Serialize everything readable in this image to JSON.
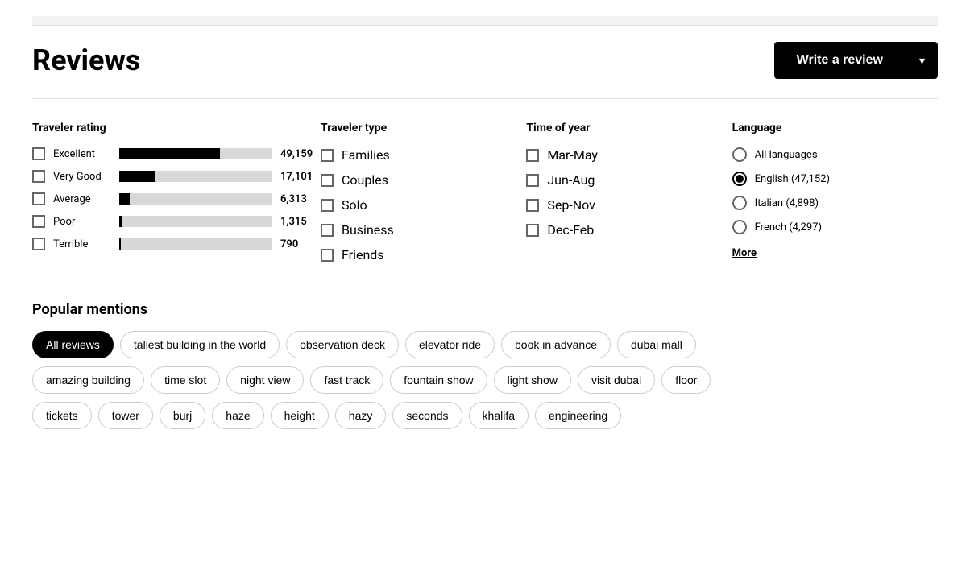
{
  "header": {
    "title": "Reviews",
    "write_review_label": "Write a review",
    "dropdown_icon": "▾"
  },
  "traveler_rating": {
    "title": "Traveler rating",
    "items": [
      {
        "label": "Excellent",
        "count": "49,159",
        "bar_pct": 66
      },
      {
        "label": "Very Good",
        "count": "17,101",
        "bar_pct": 23
      },
      {
        "label": "Average",
        "count": "6,313",
        "bar_pct": 7
      },
      {
        "label": "Poor",
        "count": "1,315",
        "bar_pct": 2
      },
      {
        "label": "Terrible",
        "count": "790",
        "bar_pct": 1
      }
    ]
  },
  "traveler_type": {
    "title": "Traveler type",
    "items": [
      "Families",
      "Couples",
      "Solo",
      "Business",
      "Friends"
    ]
  },
  "time_of_year": {
    "title": "Time of year",
    "items": [
      "Mar-May",
      "Jun-Aug",
      "Sep-Nov",
      "Dec-Feb"
    ]
  },
  "language": {
    "title": "Language",
    "items": [
      {
        "label": "All languages",
        "selected": false
      },
      {
        "label": "English (47,152)",
        "selected": true
      },
      {
        "label": "Italian (4,898)",
        "selected": false
      },
      {
        "label": "French (4,297)",
        "selected": false
      }
    ],
    "more_label": "More"
  },
  "popular_mentions": {
    "title": "Popular mentions",
    "rows": [
      [
        "All reviews",
        "tallest building in the world",
        "observation deck",
        "elevator ride",
        "book in advance",
        "dubai mall"
      ],
      [
        "amazing building",
        "time slot",
        "night view",
        "fast track",
        "fountain show",
        "light show",
        "visit dubai",
        "floor"
      ],
      [
        "tickets",
        "tower",
        "burj",
        "haze",
        "height",
        "hazy",
        "seconds",
        "khalifa",
        "engineering"
      ]
    ]
  }
}
